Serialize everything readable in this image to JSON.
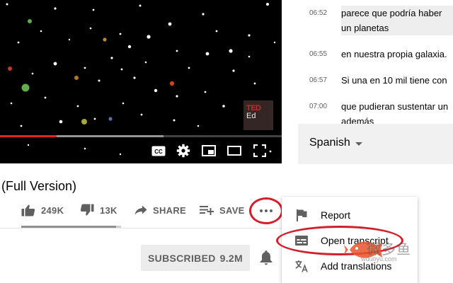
{
  "player": {
    "progress": {
      "played_fraction": 0.2,
      "buffered_fraction": 0.58
    },
    "ted_logo": {
      "brand": "TED",
      "sub": "Ed"
    },
    "controls": [
      "closed-captions-icon",
      "settings-gear-icon",
      "miniplayer-icon",
      "theater-mode-icon",
      "fullscreen-icon"
    ]
  },
  "transcript": {
    "rows": [
      {
        "time": "06:52",
        "text": "parece que podría haber un planetas",
        "active": true
      },
      {
        "time": "06:55",
        "text": "en nuestra propia galaxia.",
        "active": false
      },
      {
        "time": "06:57",
        "text": "Si una en 10 mil tiene con",
        "active": false
      },
      {
        "time": "07:00",
        "text": "que pudieran sustentar un además",
        "active": false
      }
    ],
    "language": "Spanish"
  },
  "video": {
    "title": "(Full Version)",
    "likes": "249K",
    "dislikes": "13K",
    "share_label": "SHARE",
    "save_label": "SAVE",
    "like_ratio": 0.95
  },
  "subscribe": {
    "label": "SUBSCRIBED",
    "count": "9.2M"
  },
  "menu": {
    "items": [
      {
        "label": "Report",
        "icon": "flag-icon"
      },
      {
        "label": "Open transcript",
        "icon": "transcript-icon"
      },
      {
        "label": "Add translations",
        "icon": "translate-icon"
      }
    ]
  },
  "watermark": {
    "text": "微多鱼",
    "url": "wduoyu.com"
  },
  "colors": {
    "highlight_circle": "#d21f2b",
    "progress_red": "#e62117",
    "ted_red": "#e62b1e",
    "watermark_orange": "#e8542c"
  }
}
